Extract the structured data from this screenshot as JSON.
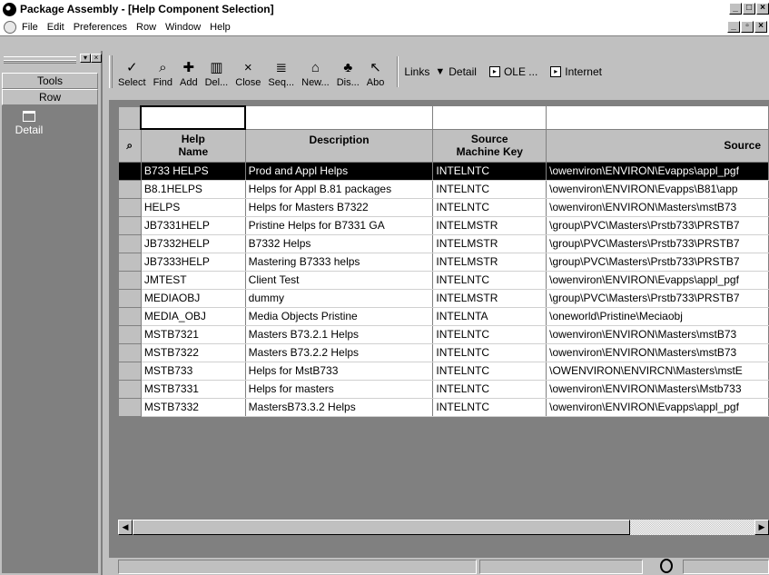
{
  "window": {
    "title": "Package Assembly - [Help Component Selection]",
    "controls": [
      "_",
      "□",
      "×"
    ]
  },
  "menu": {
    "items": [
      "File",
      "Edit",
      "Preferences",
      "Row",
      "Window",
      "Help"
    ],
    "doc_controls": [
      "_",
      "▫",
      "×"
    ]
  },
  "left_panel": {
    "tools_label": "Tools",
    "row_label": "Row",
    "detail_label": "Detail"
  },
  "toolbar": {
    "buttons": [
      {
        "label": "Select",
        "icon": "check-icon",
        "glyph": "✓"
      },
      {
        "label": "Find",
        "icon": "find-icon",
        "glyph": "⌕"
      },
      {
        "label": "Add",
        "icon": "add-icon",
        "glyph": "✚"
      },
      {
        "label": "Del...",
        "icon": "delete-icon",
        "glyph": "▥"
      },
      {
        "label": "Close",
        "icon": "close-icon",
        "glyph": "×"
      },
      {
        "label": "Seq...",
        "icon": "sequence-icon",
        "glyph": "≣"
      },
      {
        "label": "New...",
        "icon": "new-icon",
        "glyph": "⌂"
      },
      {
        "label": "Dis...",
        "icon": "display-icon",
        "glyph": "♣"
      },
      {
        "label": "Abo",
        "icon": "about-icon",
        "glyph": "↖"
      }
    ],
    "links_label": "Links",
    "detail_label": "Detail",
    "ole_label": "OLE ...",
    "internet_label": "Internet"
  },
  "grid": {
    "columns": [
      {
        "key": "name",
        "label": "Help\nName"
      },
      {
        "key": "desc",
        "label": "Description"
      },
      {
        "key": "machine",
        "label": "Source\nMachine Key"
      },
      {
        "key": "source",
        "label": "Source"
      }
    ],
    "rows": [
      {
        "name": "B733 HELPS",
        "desc": "Prod and Appl Helps",
        "machine": "INTELNTC",
        "source": "\\owenviron\\ENVIRON\\Evapps\\appl_pgf",
        "selected": true
      },
      {
        "name": "B8.1HELPS",
        "desc": "Helps for Appl B.81 packages",
        "machine": "INTELNTC",
        "source": "\\owenviron\\ENVIRON\\Evapps\\B81\\app",
        "selected": false
      },
      {
        "name": "HELPS",
        "desc": "Helps for Masters B7322",
        "machine": "INTELNTC",
        "source": "\\owenviron\\ENVIRON\\Masters\\mstB73",
        "selected": false
      },
      {
        "name": "JB7331HELP",
        "desc": "Pristine Helps for B7331 GA",
        "machine": "INTELMSTR",
        "source": "\\group\\PVC\\Masters\\Prstb733\\PRSTB7",
        "selected": false
      },
      {
        "name": "JB7332HELP",
        "desc": "B7332 Helps",
        "machine": "INTELMSTR",
        "source": "\\group\\PVC\\Masters\\Prstb733\\PRSTB7",
        "selected": false
      },
      {
        "name": "JB7333HELP",
        "desc": "Mastering B7333 helps",
        "machine": "INTELMSTR",
        "source": "\\group\\PVC\\Masters\\Prstb733\\PRSTB7",
        "selected": false
      },
      {
        "name": "JMTEST",
        "desc": "Client Test",
        "machine": "INTELNTC",
        "source": "\\owenviron\\ENVIRON\\Evapps\\appl_pgf",
        "selected": false
      },
      {
        "name": "MEDIAOBJ",
        "desc": "dummy",
        "machine": "INTELMSTR",
        "source": "\\group\\PVC\\Masters\\Prstb733\\PRSTB7",
        "selected": false
      },
      {
        "name": "MEDIA_OBJ",
        "desc": "Media Objects Pristine",
        "machine": "INTELNTA",
        "source": "\\oneworld\\Pristine\\Meciaobj",
        "selected": false
      },
      {
        "name": "MSTB7321",
        "desc": "Masters B73.2.1 Helps",
        "machine": "INTELNTC",
        "source": "\\owenviron\\ENVIRON\\Masters\\mstB73",
        "selected": false
      },
      {
        "name": "MSTB7322",
        "desc": "Masters B73.2.2 Helps",
        "machine": "INTELNTC",
        "source": "\\owenviron\\ENVIRON\\Masters\\mstB73",
        "selected": false
      },
      {
        "name": "MSTB733",
        "desc": "Helps for MstB733",
        "machine": "INTELNTC",
        "source": "\\OWENVIRON\\ENVIRCN\\Masters\\mstE",
        "selected": false
      },
      {
        "name": "MSTB7331",
        "desc": "Helps for masters",
        "machine": "INTELNTC",
        "source": "\\owenviron\\ENVIRON\\Masters\\Mstb733",
        "selected": false
      },
      {
        "name": "MSTB7332",
        "desc": "MastersB73.3.2 Helps",
        "machine": "INTELNTC",
        "source": "\\owenviron\\ENVIRON\\Evapps\\appl_pgf",
        "selected": false
      }
    ]
  }
}
